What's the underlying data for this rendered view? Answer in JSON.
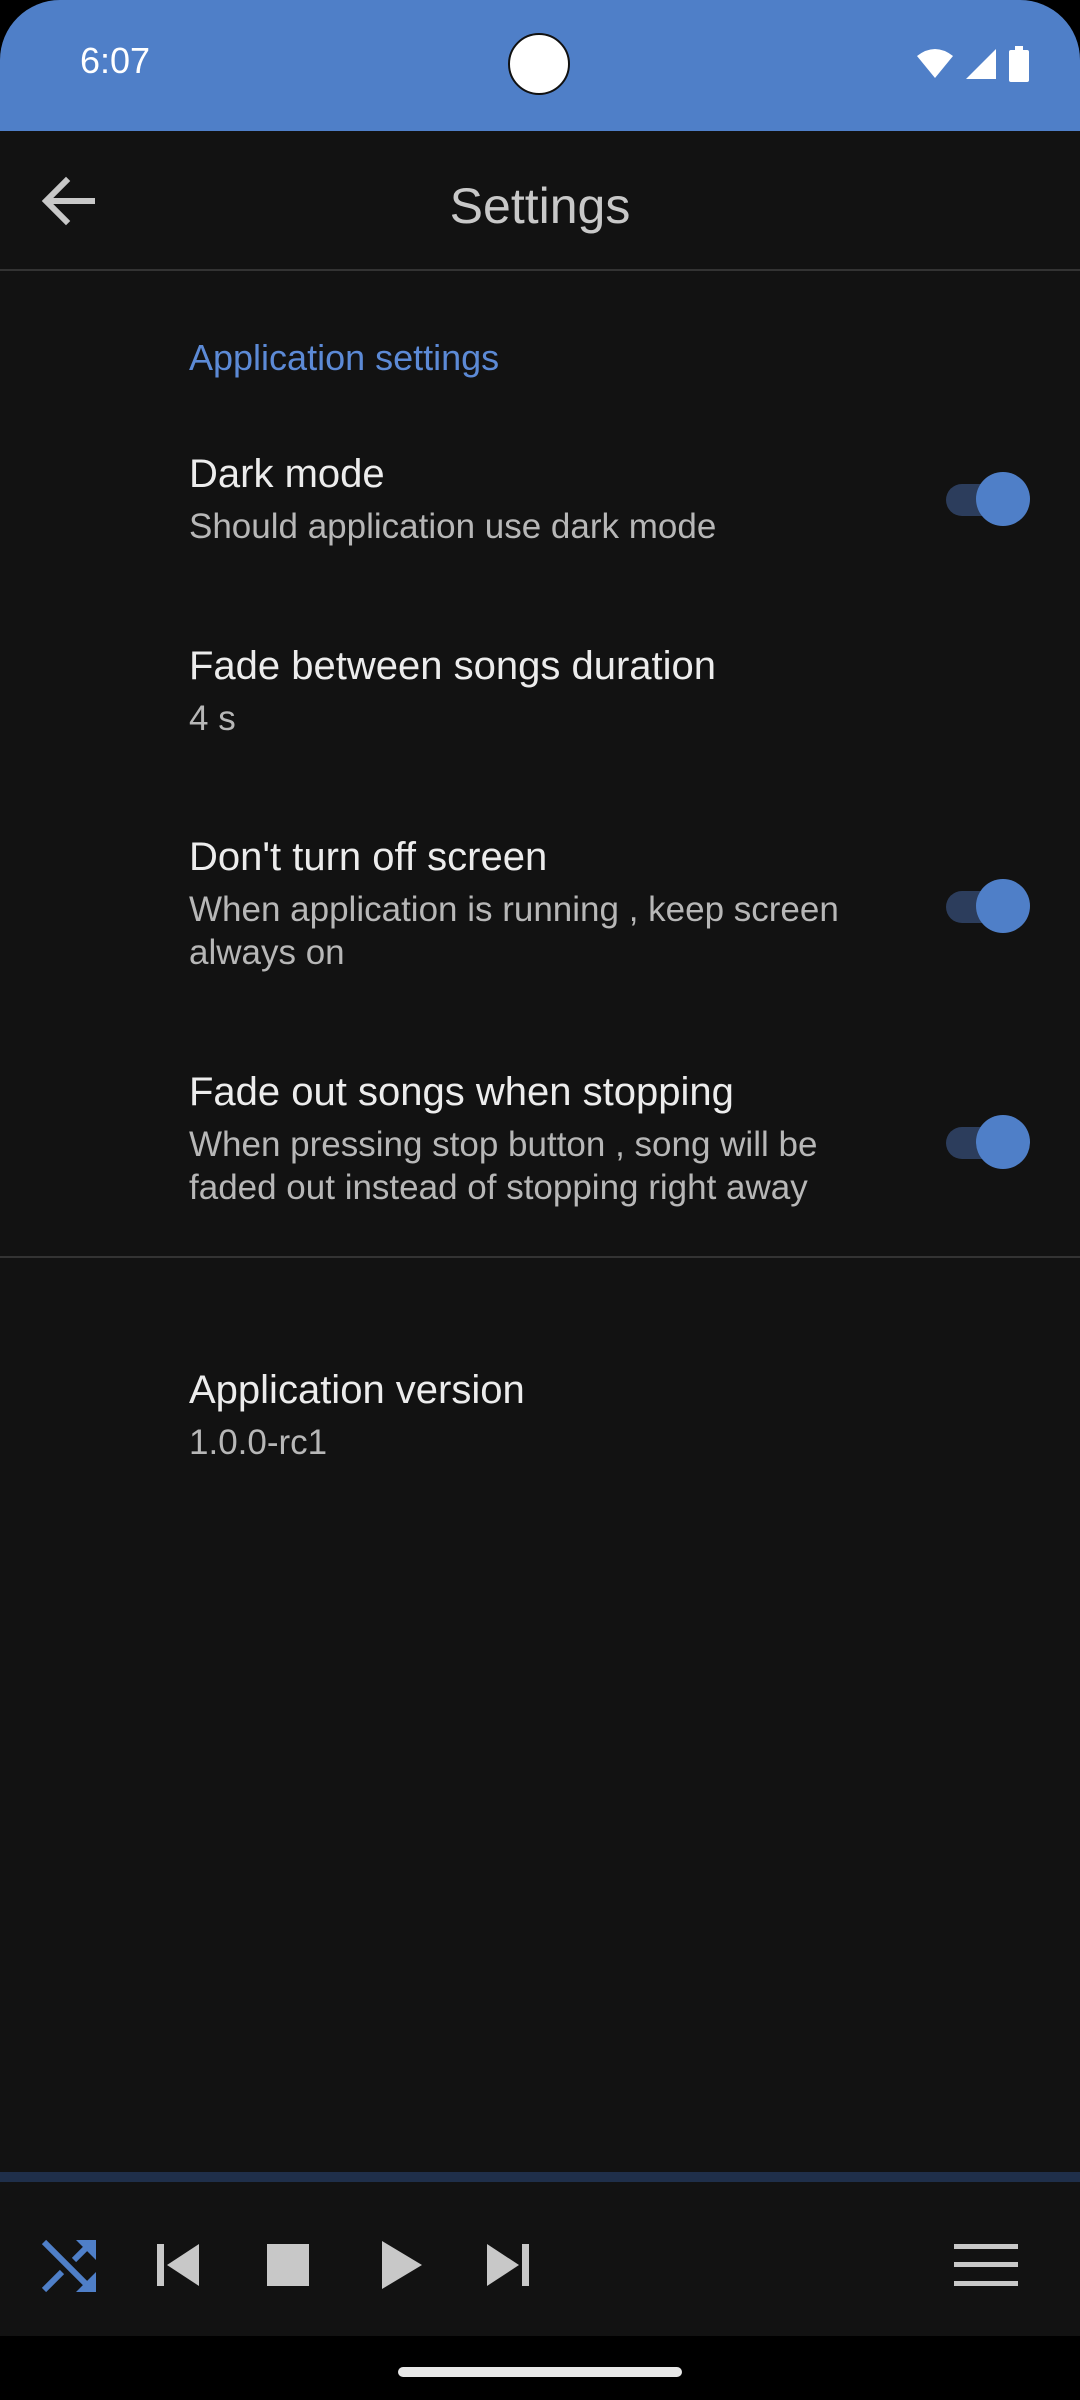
{
  "status_bar": {
    "time": "6:07"
  },
  "app_bar": {
    "title": "Settings"
  },
  "section": {
    "header": "Application settings"
  },
  "preferences": [
    {
      "title": "Dark mode",
      "summary": "Should application use dark mode",
      "switch_on": true
    },
    {
      "title": "Fade between songs duration",
      "summary": "4 s"
    },
    {
      "title": "Don't turn off screen",
      "summary": "When application is running , keep screen always on",
      "switch_on": true
    },
    {
      "title": "Fade out songs when stopping",
      "summary": "When pressing stop button , song will be faded out instead of stopping right away",
      "switch_on": true
    },
    {
      "title": "Application version",
      "summary": "1.0.0-rc1"
    }
  ],
  "player": {
    "icons": [
      "shuffle-icon",
      "skip-previous-icon",
      "stop-icon",
      "play-icon",
      "skip-next-icon",
      "menu-icon"
    ]
  },
  "colors": {
    "accent": "#4f7fc8",
    "background": "#121212",
    "header": "#5c8ad6"
  }
}
